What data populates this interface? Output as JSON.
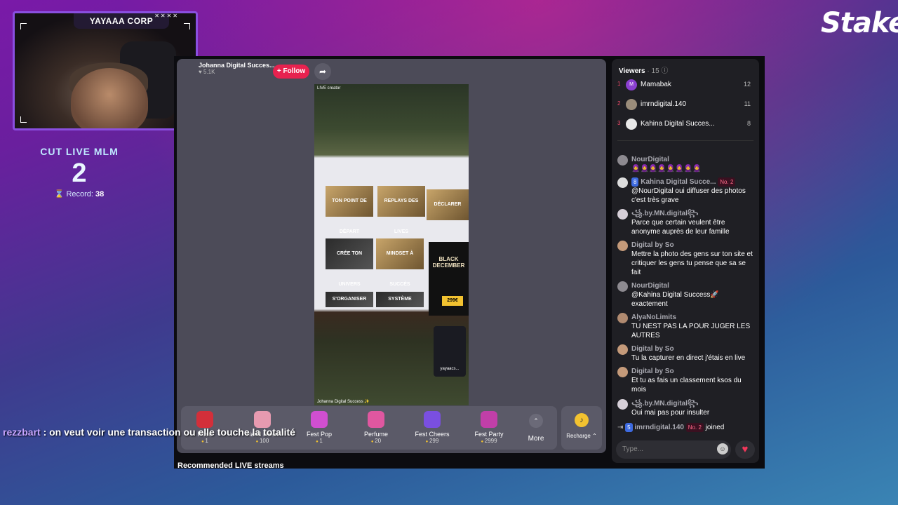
{
  "overlay": {
    "brand": "Stake",
    "cam_title": "YAYAAA CORP",
    "cam_x": "✕✕✕✕",
    "counter_title": "CUT LIVE MLM",
    "counter_value": "2",
    "record_label": "Record:",
    "record_value": "38",
    "comment_user": "rezzbart",
    "comment_text": " : on veut voir une transaction ou elle touche la totalité"
  },
  "stream": {
    "host_name": "Johanna Digital Succes...",
    "host_likes": "♥ 5.1K",
    "follow_label": "+ Follow",
    "share_icon": "➦",
    "video_tag": "LIVE creator",
    "video_footer": "Johanna Digital Success ✨",
    "black_friday": "BLACK DECEMBER",
    "price": "299€",
    "overlay_user": "yayaacs...",
    "tiles": [
      "TON POINT DE DÉPART",
      "REPLAYS DES LIVES",
      "DÉCLARER",
      "CRÉE TON UNIVERS",
      "MINDSET À SUCCÈS",
      "S'ORGANISER",
      "SYSTÈME"
    ],
    "recommended": "Recommended LIVE streams"
  },
  "gifts": [
    {
      "label": "Rose",
      "cost": "1",
      "color": "#d32f3a"
    },
    {
      "label": "Hand Heart",
      "cost": "100",
      "color": "#e79ab0"
    },
    {
      "label": "Fest Pop",
      "cost": "1",
      "color": "#d04fd0"
    },
    {
      "label": "Perfume",
      "cost": "20",
      "color": "#e057a0"
    },
    {
      "label": "Fest Cheers",
      "cost": "299",
      "color": "#7a4fe0"
    },
    {
      "label": "Fest Party",
      "cost": "2999",
      "color": "#c13fa8"
    }
  ],
  "more_label": "More",
  "more_icon": "⌃",
  "recharge_label": "Recharge ⌃",
  "recharge_icon": "♪",
  "viewers": {
    "label": "Viewers",
    "count": "· 15 ⓘ",
    "list": [
      {
        "rank": "1",
        "name": "Mamabak",
        "score": "12",
        "initial": "M"
      },
      {
        "rank": "2",
        "name": "imrndigital.140",
        "score": "11",
        "initial": ""
      },
      {
        "rank": "3",
        "name": "Kahina Digital Succes...",
        "score": "8",
        "initial": ""
      }
    ]
  },
  "chat": [
    {
      "user": "NourDigital",
      "badge": "",
      "rank": "",
      "text": "🧕🧕🧕🧕🧕🧕🧕🧕"
    },
    {
      "user": "Kahina Digital Succe...",
      "badge": "8",
      "rank": "No. 2",
      "text": "@NourDigital oui diffuser des photos c'est très grave"
    },
    {
      "user": "꧁.by.MN.digital꧂",
      "badge": "",
      "rank": "",
      "text": "Parce que certain veulent être anonyme auprès de leur famille"
    },
    {
      "user": "Digital by So",
      "badge": "",
      "rank": "",
      "text": "Mettre la photo des gens sur ton site et critiquer les gens tu pense que sa se fait"
    },
    {
      "user": "NourDigital",
      "badge": "",
      "rank": "",
      "text": "@Kahina Digital Success🚀 exactement"
    },
    {
      "user": "AlyaNoLimits",
      "badge": "",
      "rank": "",
      "text": "TU NEST PAS LA POUR JUGER LES AUTRES"
    },
    {
      "user": "Digital by So",
      "badge": "",
      "rank": "",
      "text": "Tu la capturer en direct j'étais en live"
    },
    {
      "user": "Digital by So",
      "badge": "",
      "rank": "",
      "text": "Et tu as fais un classement ksos du mois"
    },
    {
      "user": "꧁.by.MN.digital꧂",
      "badge": "",
      "rank": "",
      "text": "Oui mai pas pour insulter"
    }
  ],
  "joined": {
    "badge": "5",
    "user": "imrndigital.140",
    "rank": "No. 2",
    "text": "joined"
  },
  "input": {
    "placeholder": "Type...",
    "emoji_icon": "☺",
    "heart_icon": "♥"
  }
}
